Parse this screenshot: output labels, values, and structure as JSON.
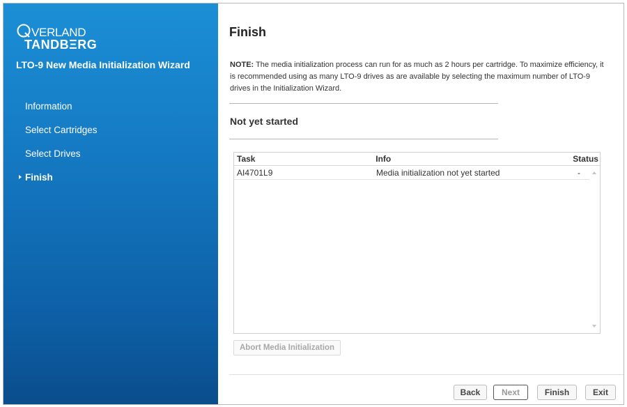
{
  "brand": {
    "line1_initial": "O",
    "line1_rest": "VERLAND",
    "line2": "TANDBΞRG"
  },
  "sidebar": {
    "wizard_title": "LTO-9 New Media Initialization Wizard",
    "items": [
      {
        "label": "Information"
      },
      {
        "label": "Select Cartridges"
      },
      {
        "label": "Select Drives"
      },
      {
        "label": "Finish",
        "active": true
      }
    ]
  },
  "main": {
    "title": "Finish",
    "note_label": "NOTE:",
    "note_text": " The media initialization process can run for as much as 2 hours per cartridge. To maximize efficiency, it is recommended using as many LTO-9 drives as are available by selecting the maximum number of LTO-9 drives in the Initialization Wizard.",
    "status_heading": "Not yet started",
    "table": {
      "headers": {
        "task": "Task",
        "info": "Info",
        "status": "Status"
      },
      "rows": [
        {
          "task": "AI4701L9",
          "info": "Media initialization not yet started",
          "status": "-"
        }
      ]
    },
    "abort_label": "Abort Media Initialization"
  },
  "footer": {
    "back": "Back",
    "next": "Next",
    "finish": "Finish",
    "exit": "Exit"
  },
  "colors": {
    "sidebar_top": "#1b8fd6",
    "sidebar_bottom": "#0a4d8c"
  }
}
